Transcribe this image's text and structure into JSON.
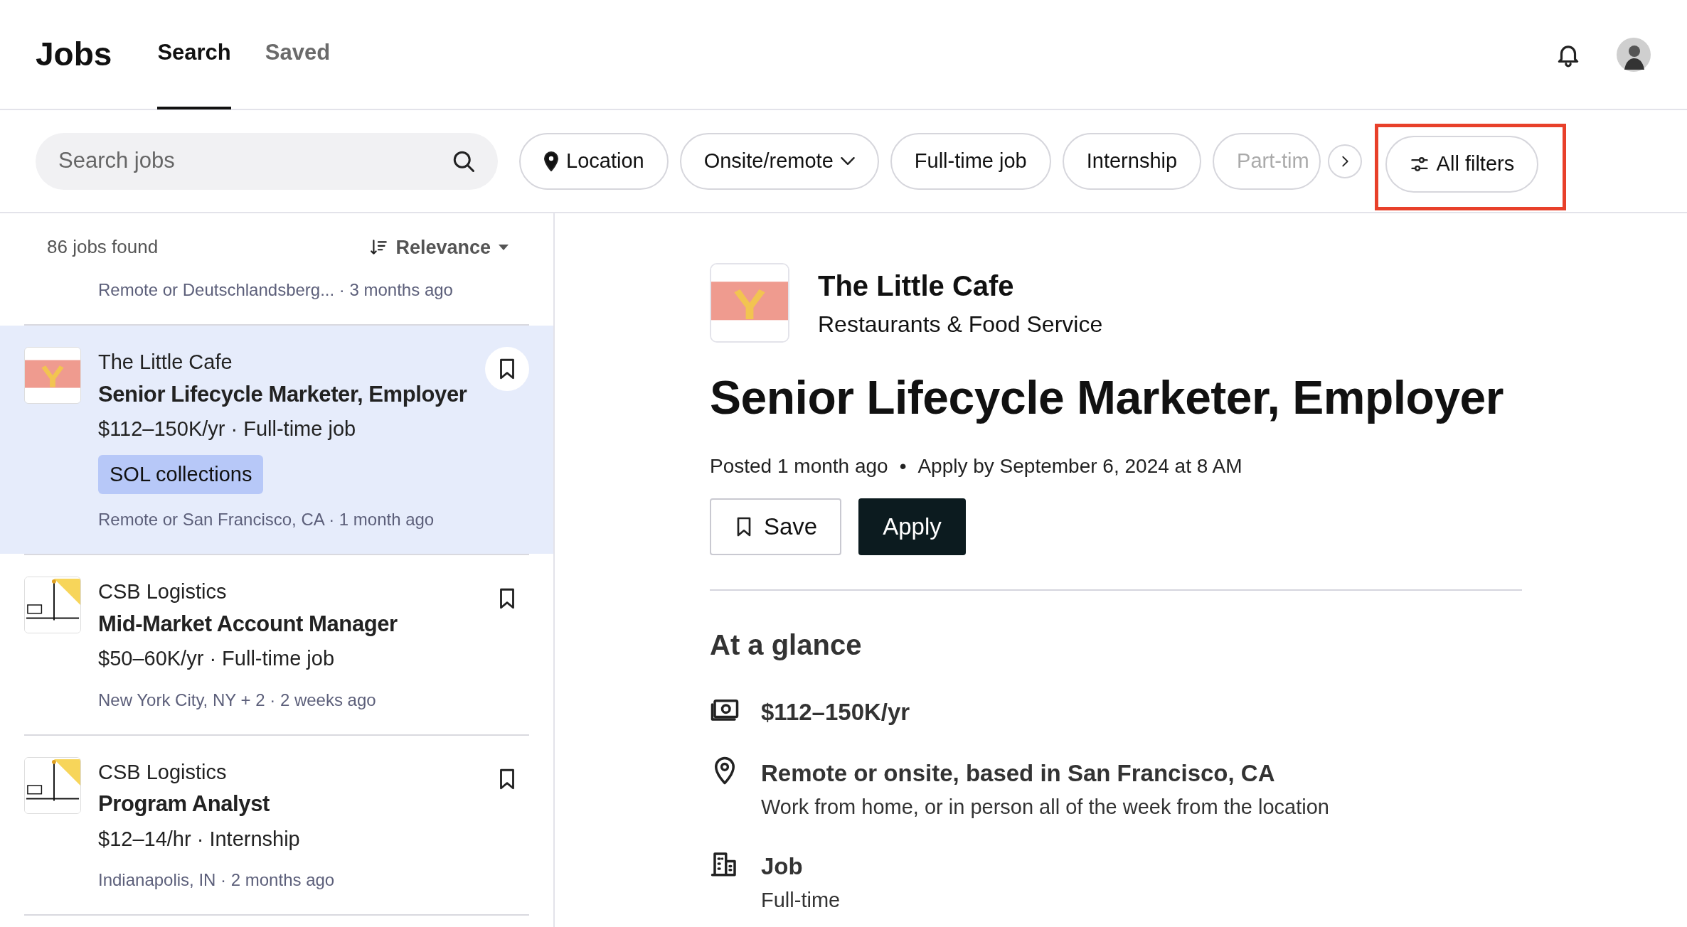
{
  "app": {
    "title": "Jobs"
  },
  "nav_tabs": [
    {
      "label": "Search",
      "selected": true
    },
    {
      "label": "Saved",
      "selected": false
    }
  ],
  "search": {
    "placeholder": "Search jobs"
  },
  "filters": [
    {
      "label": "Location",
      "kind": "location"
    },
    {
      "label": "Onsite/remote",
      "kind": "dropdown"
    },
    {
      "label": "Full-time job",
      "kind": "plain"
    },
    {
      "label": "Internship",
      "kind": "plain"
    },
    {
      "label": "Part-tim",
      "kind": "faded"
    }
  ],
  "all_filters": {
    "label": "All filters",
    "highlighted": true
  },
  "results": {
    "count": "86 jobs found",
    "sort": "Relevance"
  },
  "partial_job": {
    "meta": "Remote or Deutschlandsberg... · 3 months ago"
  },
  "jobs": [
    {
      "company": "The Little Cafe",
      "title": "Senior Lifecycle Marketer, Employer",
      "pay": "$112–150K/yr · Full-time job",
      "tag": "SOL collections",
      "meta": "Remote or San Francisco, CA · 1 month ago",
      "selected": true
    },
    {
      "company": "CSB Logistics",
      "title": "Mid-Market Account Manager",
      "pay": "$50–60K/yr · Full-time job",
      "meta": "New York City, NY + 2 · 2 weeks ago",
      "selected": false
    },
    {
      "company": "CSB Logistics",
      "title": "Program Analyst",
      "pay": "$12–14/hr · Internship",
      "meta": "Indianapolis, IN · 2 months ago",
      "selected": false
    }
  ],
  "detail": {
    "company": "The Little Cafe",
    "category": "Restaurants & Food Service",
    "title": "Senior Lifecycle Marketer, Employer",
    "posted": "Posted 1 month ago",
    "separator": "•",
    "apply_by": "Apply by September 6, 2024 at 8 AM",
    "save_label": "Save",
    "apply_label": "Apply",
    "section": "At a glance",
    "glance": [
      {
        "kind": "pay",
        "title": "$112–150K/yr"
      },
      {
        "kind": "location",
        "title": "Remote or onsite, based in San Francisco, CA",
        "subtitle": "Work from home, or in person all of the week from the location"
      },
      {
        "kind": "job",
        "title": "Job",
        "subtitle": "Full-time"
      }
    ]
  }
}
